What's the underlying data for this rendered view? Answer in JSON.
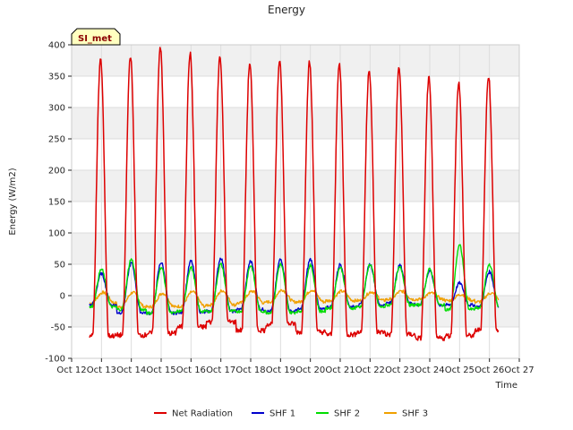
{
  "chart_data": {
    "type": "line",
    "title": "Energy",
    "xlabel": "Time",
    "ylabel": "Energy (W/m2)",
    "badge": "SI_met",
    "ylim": [
      -100,
      400
    ],
    "xlim": [
      12,
      27
    ],
    "yticks": [
      -100,
      -50,
      0,
      50,
      100,
      150,
      200,
      250,
      300,
      350,
      400
    ],
    "xticks": [
      {
        "value": 12,
        "label": "Oct 12"
      },
      {
        "value": 13,
        "label": "Oct 13"
      },
      {
        "value": 14,
        "label": "Oct 14"
      },
      {
        "value": 15,
        "label": "Oct 15"
      },
      {
        "value": 16,
        "label": "Oct 16"
      },
      {
        "value": 17,
        "label": "Oct 17"
      },
      {
        "value": 18,
        "label": "Oct 18"
      },
      {
        "value": 19,
        "label": "Oct 19"
      },
      {
        "value": 20,
        "label": "Oct 20"
      },
      {
        "value": 21,
        "label": "Oct 21"
      },
      {
        "value": 22,
        "label": "Oct 22"
      },
      {
        "value": 23,
        "label": "Oct 23"
      },
      {
        "value": 24,
        "label": "Oct 24"
      },
      {
        "value": 25,
        "label": "Oct 25"
      },
      {
        "value": 26,
        "label": "Oct 26"
      },
      {
        "value": 27,
        "label": "Oct 27"
      }
    ],
    "grid": true,
    "legend_position": "bottom",
    "series": [
      {
        "name": "Net Radiation",
        "color": "#dd0000",
        "days": [
          13,
          14,
          15,
          16,
          17,
          18,
          19,
          20,
          21,
          22,
          23,
          24,
          25,
          26
        ],
        "peaks": [
          377,
          383,
          397,
          386,
          382,
          371,
          376,
          372,
          369,
          361,
          363,
          347,
          339,
          350
        ],
        "night": [
          -64,
          -63,
          -60,
          -50,
          -42,
          -55,
          -45,
          -58,
          -62,
          -58,
          -62,
          -68,
          -64,
          -55
        ]
      },
      {
        "name": "SHF 1",
        "color": "#0000cc",
        "days": [
          13,
          14,
          15,
          16,
          17,
          18,
          19,
          20,
          21,
          22,
          23,
          24,
          25,
          26
        ],
        "peaks": [
          35,
          52,
          53,
          55,
          60,
          55,
          58,
          58,
          50,
          50,
          48,
          40,
          20,
          38
        ],
        "night": [
          -15,
          -27,
          -28,
          -27,
          -25,
          -22,
          -25,
          -22,
          -18,
          -15,
          -12,
          -15,
          -15,
          -18
        ]
      },
      {
        "name": "SHF 2",
        "color": "#00dd00",
        "days": [
          13,
          14,
          15,
          16,
          17,
          18,
          19,
          20,
          21,
          22,
          23,
          24,
          25,
          26
        ],
        "peaks": [
          42,
          58,
          45,
          45,
          50,
          48,
          50,
          48,
          45,
          50,
          45,
          42,
          80,
          50
        ],
        "night": [
          -18,
          -22,
          -28,
          -25,
          -25,
          -25,
          -27,
          -25,
          -20,
          -18,
          -15,
          -15,
          -22,
          -20
        ]
      },
      {
        "name": "SHF 3",
        "color": "#f0a000",
        "days": [
          13,
          14,
          15,
          16,
          17,
          18,
          19,
          20,
          21,
          22,
          23,
          24,
          25,
          26
        ],
        "peaks": [
          5,
          5,
          4,
          6,
          8,
          7,
          9,
          9,
          7,
          6,
          7,
          4,
          2,
          4
        ],
        "night": [
          -12,
          -18,
          -18,
          -17,
          -15,
          -12,
          -10,
          -10,
          -8,
          -8,
          -6,
          -6,
          -8,
          -10
        ]
      }
    ]
  }
}
